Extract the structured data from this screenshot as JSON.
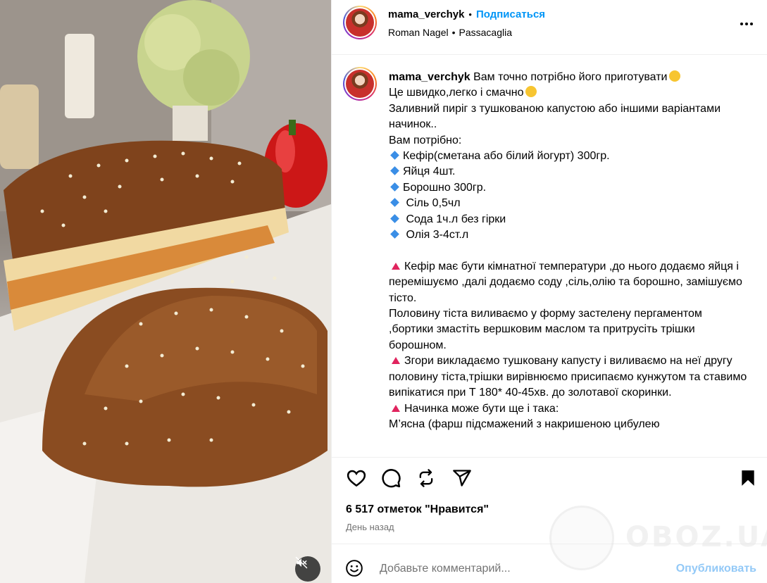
{
  "post": {
    "username": "mama_verchyk",
    "follow_label": "Подписаться",
    "audio_artist": "Roman Nagel",
    "audio_track": "Passacaglia",
    "more_icon": "more-horizontal-icon"
  },
  "caption": {
    "username": "mama_verchyk",
    "lines": {
      "l1": "Вам точно потрібно його приготувати",
      "l2": "Це швидко,легко і смачно",
      "l3": "Заливний пиріг з тушкованою капустою або іншими варіантами начинок..",
      "l4": "Вам потрібно:",
      "b1": "Кефір(сметана або білий йогурт) 300гр.",
      "b2": "Яйця 4шт.",
      "b3": "Борошно 300гр.",
      "b4": " Сіль 0,5чл",
      "b5": " Сода 1ч.л без гірки",
      "b6": " Олія 3-4ст.л",
      "s1": "Кефір має бути кімнатної температури ,до нього додаємо яйця і перемішуємо ,далі додаємо соду ,сіль,олію та борошно, замішуємо тісто.",
      "s2": "Половину тіста виливаємо у форму застелену пергаментом ,бортики змастіть вершковим маслом та притрусіть трішки борошном.",
      "s3": "Згори викладаємо тушковану капусту і виливаємо на неї другу половину тіста,трішки вирівнюємо присипаємо кунжутом та ставимо випікатися при Т 180* 40-45хв. до золотавої скоринки.",
      "s4": "Начинка може бути ще і така:",
      "s5": "М’ясна (фарш підсмажений з накришеною цибулею"
    }
  },
  "actions": {
    "likes": "6 517 отметок \"Нравится\"",
    "time": "День назад",
    "icons": [
      "heart-icon",
      "comment-icon",
      "repost-icon",
      "share-icon",
      "bookmark-icon"
    ]
  },
  "comment": {
    "placeholder": "Добавьте комментарий...",
    "publish_label": "Опубликовать"
  },
  "watermark": {
    "text": "OBOZ.UA"
  },
  "colors": {
    "link_blue": "#0095f6",
    "publish_disabled": "#93c9f7",
    "secondary_text": "#737373",
    "bullet_blue": "#3a8ee6",
    "triangle_red": "#e0245e"
  }
}
